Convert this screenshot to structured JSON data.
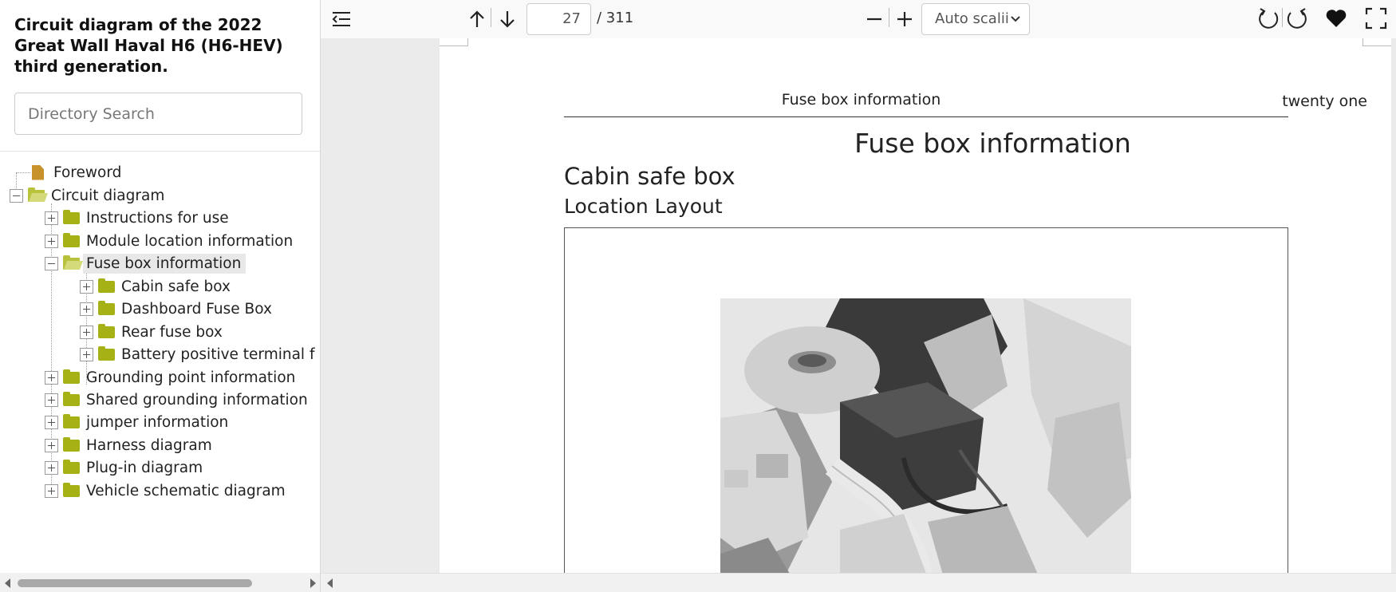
{
  "sidebar": {
    "doc_title": "Circuit diagram of the 2022 Great Wall Haval H6 (H6-HEV) third generation.",
    "search_placeholder": "Directory Search",
    "tree": {
      "foreword": "Foreword",
      "circuit_diagram": "Circuit diagram",
      "instructions": "Instructions for use",
      "module_location": "Module location information",
      "fuse_box": "Fuse box information",
      "cabin_safe_box": "Cabin safe box",
      "dashboard_fuse_box": "Dashboard Fuse Box",
      "rear_fuse_box": "Rear fuse box",
      "battery_terminal": "Battery positive terminal f",
      "grounding_point": "Grounding point information",
      "shared_grounding": "Shared grounding information",
      "jumper": "jumper information",
      "harness": "Harness diagram",
      "plugin": "Plug-in diagram",
      "vehicle_schematic": "Vehicle schematic diagram"
    }
  },
  "toolbar": {
    "page_current": "27",
    "page_total": "/ 311",
    "scale": "Auto scalii"
  },
  "document": {
    "running_header": "Fuse box information",
    "page_number": "twenty one",
    "heading_1": "Fuse box information",
    "heading_2": "Cabin safe box",
    "heading_3": "Location Layout"
  }
}
